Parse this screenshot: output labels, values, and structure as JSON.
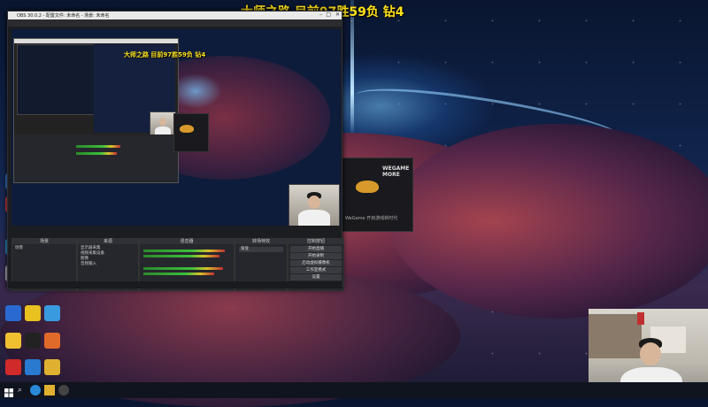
{
  "stream_caption": "大师之路 目前97胜59负 钻4",
  "obs": {
    "title": "OBS 30.0.2 - 配置文件: 未命名 - 场景: 未命名",
    "nested_caption": "大师之路 目前97胜59负 钻4",
    "docks": {
      "scenes": "场景",
      "sources": "来源",
      "mixer": "混音器",
      "transitions": "转场特效",
      "controls": "控制按钮"
    },
    "scene_items": [
      "场景"
    ],
    "source_items": [
      "显示器采集",
      "视频采集设备",
      "图像",
      "音频输入"
    ],
    "control_buttons": [
      "开始直播",
      "开始录制",
      "启动虚拟摄像机",
      "工作室模式",
      "设置",
      "退出"
    ],
    "transition_value": "渐变"
  },
  "wegame": {
    "title": "WEGAME MORE",
    "subtitle": "WeGame 开启游戏新时代"
  },
  "desktop_icons": [
    "",
    "",
    "",
    "",
    "",
    "",
    "",
    "",
    "",
    "",
    "",
    "",
    "",
    ""
  ],
  "colors": {
    "caption": "#ffe21a",
    "obs_bg": "#1c1d21"
  }
}
